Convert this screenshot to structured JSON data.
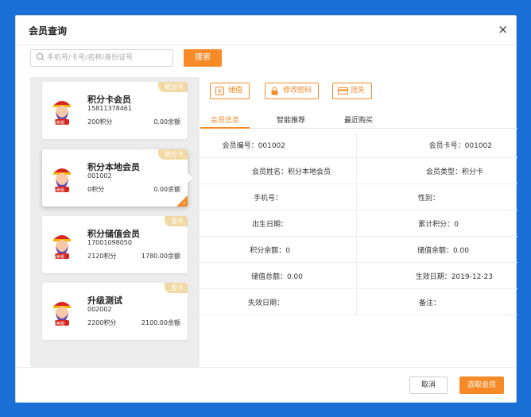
{
  "dialog": {
    "title": "会员查询",
    "close_glyph": "×"
  },
  "search": {
    "placeholder": "手机号/卡号/名称/身份证号",
    "button_label": "搜索"
  },
  "members": [
    {
      "tag": "积分卡",
      "name": "积分卡会员",
      "phone": "15811378461",
      "points": "200积分",
      "balance": "0.00余额",
      "selected": false
    },
    {
      "tag": "积分卡",
      "name": "积分本地会员",
      "phone": "001002",
      "points": "0积分",
      "balance": "0.00余额",
      "selected": true
    },
    {
      "tag": "金卡",
      "name": "积分储值会员",
      "phone": "17001098050",
      "points": "2120积分",
      "balance": "1780.00余额",
      "selected": false
    },
    {
      "tag": "金卡",
      "name": "升级测试",
      "phone": "002002",
      "points": "2200积分",
      "balance": "2100.00余额",
      "selected": false
    }
  ],
  "avatar_badge": "保卖题",
  "actions": {
    "store_value": "储值",
    "change_password": "修改密码",
    "report_loss": "挂失"
  },
  "tabs": [
    "会员信息",
    "智能推荐",
    "最近购买"
  ],
  "details": [
    [
      "会员编号：001002",
      "会员卡号：001002"
    ],
    [
      "会员姓名：积分本地会员",
      "会员类型：积分卡"
    ],
    [
      "手机号：",
      "性别："
    ],
    [
      "出生日期：",
      "累计积分：0"
    ],
    [
      "积分余额：0",
      "储值余额：0.00"
    ],
    [
      "储值总额：0.00",
      "生效日期：2019-12-23"
    ],
    [
      "失效日期：",
      "备注："
    ]
  ],
  "footer": {
    "cancel_label": "取消",
    "select_label": "选取会员"
  },
  "colors": {
    "accent": "#f58a26",
    "tag": "#f1d9a5",
    "background": "#1a6fd6"
  }
}
